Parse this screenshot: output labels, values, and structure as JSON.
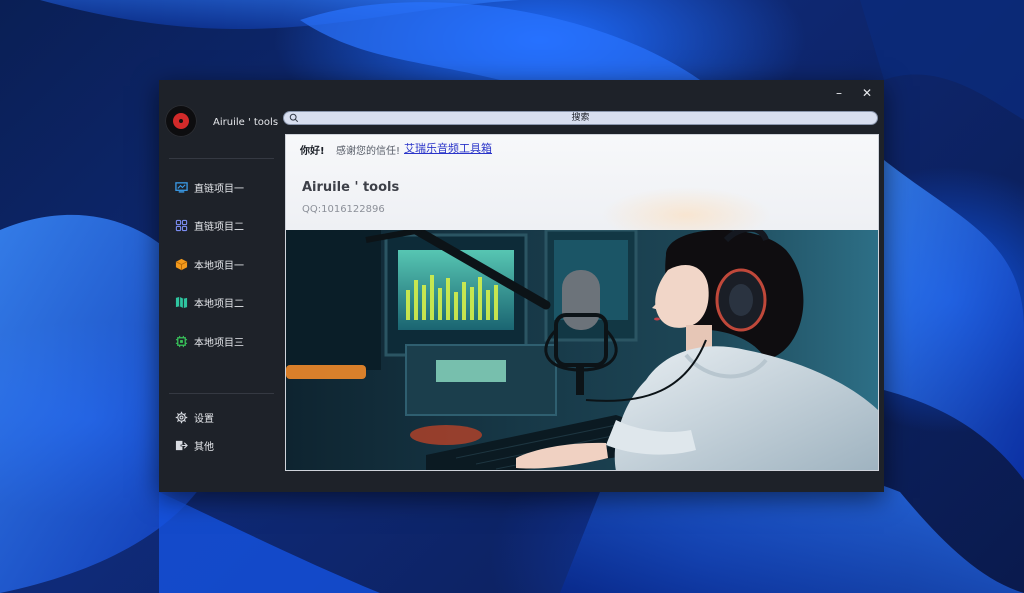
{
  "window": {
    "controls": {
      "minimize": "–",
      "close": "✕"
    }
  },
  "sidebar": {
    "app_name": "Airuile ' tools",
    "items": [
      {
        "label": "直链项目一",
        "icon": "monitor-icon",
        "color": "#3a9be8"
      },
      {
        "label": "直链项目二",
        "icon": "grid-icon",
        "color": "#7b8cf0"
      },
      {
        "label": "本地项目一",
        "icon": "cube-icon",
        "color": "#f39a1c"
      },
      {
        "label": "本地项目二",
        "icon": "map-icon",
        "color": "#2fc6a0"
      },
      {
        "label": "本地项目三",
        "icon": "chip-icon",
        "color": "#38c35a"
      }
    ],
    "bottom_items": [
      {
        "label": "设置",
        "icon": "gear-icon"
      },
      {
        "label": "其他",
        "icon": "exit-icon"
      }
    ]
  },
  "search": {
    "label": "搜索"
  },
  "content": {
    "greeting": "你好!",
    "thanks": "感谢您的信任!",
    "link": "艾瑞乐音频工具箱",
    "title": "Airuile ' tools",
    "qq": "QQ:1016122896"
  },
  "colors": {
    "window_bg": "#1e2229",
    "search_bg": "#d8dff0",
    "link": "#2a34c9"
  }
}
